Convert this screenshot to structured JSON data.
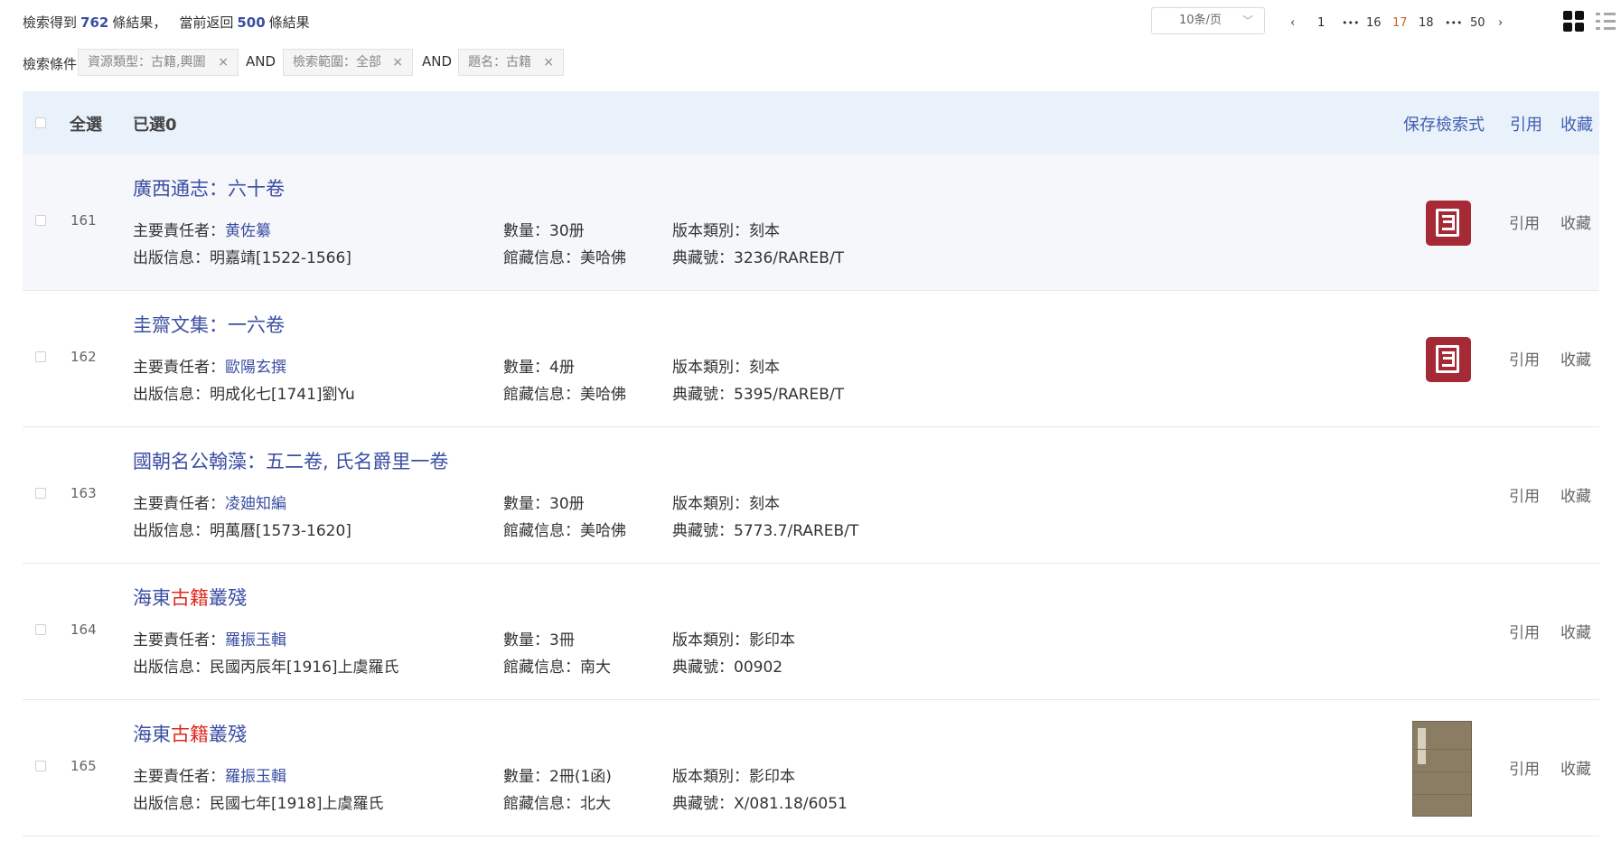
{
  "summary": {
    "prefix": "檢索得到",
    "total": "762",
    "mid": "條結果，",
    "returned_prefix": "當前返回",
    "returned": "500",
    "suffix": "條結果"
  },
  "page_size": {
    "label": "10条/页",
    "chevron_icon": "chevron-down-icon"
  },
  "pagination": {
    "prev_icon": "chevron-left-icon",
    "pages": [
      "1",
      "•••",
      "16",
      "17",
      "18",
      "•••",
      "50"
    ],
    "current": "17",
    "next_icon": "chevron-right-icon",
    "prev": "‹",
    "next": "›"
  },
  "view_toggle": {
    "grid_icon": "grid-view-icon",
    "list_icon": "list-view-icon"
  },
  "conditions": {
    "label": "檢索條件:",
    "tags": [
      {
        "text": "資源類型：古籍,輿圖",
        "close": "×"
      },
      {
        "text": "檢索範圍：全部",
        "close": "×"
      },
      {
        "text": "題名：古籍",
        "close": "×"
      }
    ],
    "and": "AND"
  },
  "header": {
    "select_all": "全選",
    "selected": "已選0",
    "save_search": "保存檢索式",
    "cite": "引用",
    "favorite": "收藏"
  },
  "colors": {
    "accent": "#3b4ea3",
    "highlight": "#e0281e",
    "header_bg": "#e9f1fb",
    "page_current": "#c8692d",
    "logo": "#a52a35"
  },
  "results": [
    {
      "index": "161",
      "title_parts": [
        "廣西通志：六十卷"
      ],
      "responsible_label": "主要責任者：",
      "responsible": "黄佐纂",
      "publish_label": "出版信息：",
      "publish": "明嘉靖[1522-1566]",
      "quantity_label": "數量：",
      "quantity": "30册",
      "library_label": "館藏信息：",
      "library": "美哈佛",
      "edition_label": "版本類別：",
      "edition": "刻本",
      "callno_label": "典藏號：",
      "callno": "3236/RAREB/T",
      "thumbnail": "library-logo-icon",
      "cite": "引用",
      "favorite": "收藏"
    },
    {
      "index": "162",
      "title_parts": [
        "圭齋文集：一六卷"
      ],
      "responsible_label": "主要責任者：",
      "responsible": "歐陽玄撰",
      "publish_label": "出版信息：",
      "publish": "明成化七[1741]劉Yu",
      "quantity_label": "數量：",
      "quantity": "4册",
      "library_label": "館藏信息：",
      "library": "美哈佛",
      "edition_label": "版本類別：",
      "edition": "刻本",
      "callno_label": "典藏號：",
      "callno": "5395/RAREB/T",
      "thumbnail": "library-logo-icon",
      "cite": "引用",
      "favorite": "收藏"
    },
    {
      "index": "163",
      "title_parts": [
        "國朝名公翰藻：五二卷, 氏名爵里一卷"
      ],
      "responsible_label": "主要責任者：",
      "responsible": "凌廸知編",
      "publish_label": "出版信息：",
      "publish": "明萬曆[1573-1620]",
      "quantity_label": "數量：",
      "quantity": "30册",
      "library_label": "館藏信息：",
      "library": "美哈佛",
      "edition_label": "版本類別：",
      "edition": "刻本",
      "callno_label": "典藏號：",
      "callno": "5773.7/RAREB/T",
      "cite": "引用",
      "favorite": "收藏"
    },
    {
      "index": "164",
      "title_parts": [
        "海東",
        "古籍",
        "叢殘"
      ],
      "responsible_label": "主要責任者：",
      "responsible": "羅振玉輯",
      "publish_label": "出版信息：",
      "publish": "民國丙辰年[1916]上虞羅氏",
      "quantity_label": "數量：",
      "quantity": "3冊",
      "library_label": "館藏信息：",
      "library": "南大",
      "edition_label": "版本類別：",
      "edition": "影印本",
      "callno_label": "典藏號：",
      "callno": "00902",
      "cite": "引用",
      "favorite": "收藏"
    },
    {
      "index": "165",
      "title_parts": [
        "海東",
        "古籍",
        "叢殘"
      ],
      "responsible_label": "主要責任者：",
      "responsible": "羅振玉輯",
      "publish_label": "出版信息：",
      "publish": "民國七年[1918]上虞羅氏",
      "quantity_label": "數量：",
      "quantity": "2冊(1函)",
      "library_label": "館藏信息：",
      "library": "北大",
      "edition_label": "版本類別：",
      "edition": "影印本",
      "callno_label": "典藏號：",
      "callno": "X/081.18/6051",
      "thumbnail": "book-cover-image",
      "cite": "引用",
      "favorite": "收藏"
    }
  ]
}
